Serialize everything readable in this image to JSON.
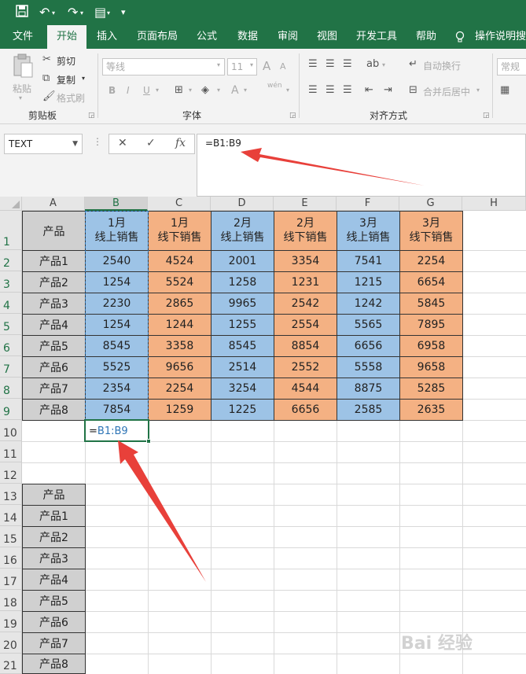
{
  "quick_access": {
    "save_icon": "save-icon",
    "undo_icon": "undo-icon",
    "redo_icon": "redo-icon",
    "form_icon": "form-icon",
    "customize_icon": "dropdown-icon"
  },
  "tabs": [
    "文件",
    "开始",
    "插入",
    "页面布局",
    "公式",
    "数据",
    "审阅",
    "视图",
    "开发工具",
    "帮助",
    "操作说明搜"
  ],
  "active_tab": "开始",
  "ribbon": {
    "clipboard": {
      "paste": "粘贴",
      "cut": "剪切",
      "copy": "复制",
      "format_painter": "格式刷",
      "group": "剪贴板"
    },
    "font": {
      "font_name": "等线",
      "font_size": "11",
      "grow": "A",
      "shrink": "A",
      "bold": "B",
      "italic": "I",
      "underline": "U",
      "font_color": "A",
      "phonetic": "wén",
      "group": "字体"
    },
    "alignment": {
      "wrap": "自动换行",
      "merge": "合并后居中",
      "group": "对齐方式"
    },
    "number": {
      "format": "常规"
    }
  },
  "formula_bar": {
    "name_box": "TEXT",
    "cancel": "✕",
    "enter": "✓",
    "fx": "fx",
    "formula": "=B1:B9"
  },
  "columns": [
    "A",
    "B",
    "C",
    "D",
    "E",
    "F",
    "G",
    "H"
  ],
  "rows": [
    "1",
    "2",
    "3",
    "4",
    "5",
    "6",
    "7",
    "8",
    "9",
    "10",
    "11",
    "12",
    "13",
    "14",
    "15",
    "16",
    "17",
    "18",
    "19",
    "20",
    "21"
  ],
  "header_row": {
    "a": "产品",
    "b": [
      "1月",
      "线上销售"
    ],
    "c": [
      "1月",
      "线下销售"
    ],
    "d": [
      "2月",
      "线上销售"
    ],
    "e": [
      "2月",
      "线下销售"
    ],
    "f": [
      "3月",
      "线上销售"
    ],
    "g": [
      "3月",
      "线下销售"
    ]
  },
  "products": [
    "产品1",
    "产品2",
    "产品3",
    "产品4",
    "产品5",
    "产品6",
    "产品7",
    "产品8"
  ],
  "table": [
    [
      "2540",
      "4524",
      "2001",
      "3354",
      "7541",
      "2254"
    ],
    [
      "1254",
      "5524",
      "1258",
      "1231",
      "1215",
      "6654"
    ],
    [
      "2230",
      "2865",
      "9965",
      "2542",
      "1242",
      "5845"
    ],
    [
      "1254",
      "1244",
      "1255",
      "2554",
      "5565",
      "7895"
    ],
    [
      "8545",
      "3358",
      "8545",
      "8854",
      "6656",
      "6958"
    ],
    [
      "5525",
      "9656",
      "2514",
      "2552",
      "5558",
      "9658"
    ],
    [
      "2354",
      "2254",
      "3254",
      "4544",
      "8875",
      "5285"
    ],
    [
      "7854",
      "1259",
      "1225",
      "6656",
      "2585",
      "2635"
    ]
  ],
  "edit_cell": {
    "eq": "=",
    "ref": "B1:B9"
  },
  "second_list": {
    "header": "产品",
    "items": [
      "产品1",
      "产品2",
      "产品3",
      "产品4",
      "产品5",
      "产品6",
      "产品7",
      "产品8"
    ]
  },
  "colors": {
    "green": "#217346",
    "blue_fill": "#9dc3e6",
    "orange_fill": "#f4b183",
    "arrow_red": "#e8403a"
  }
}
